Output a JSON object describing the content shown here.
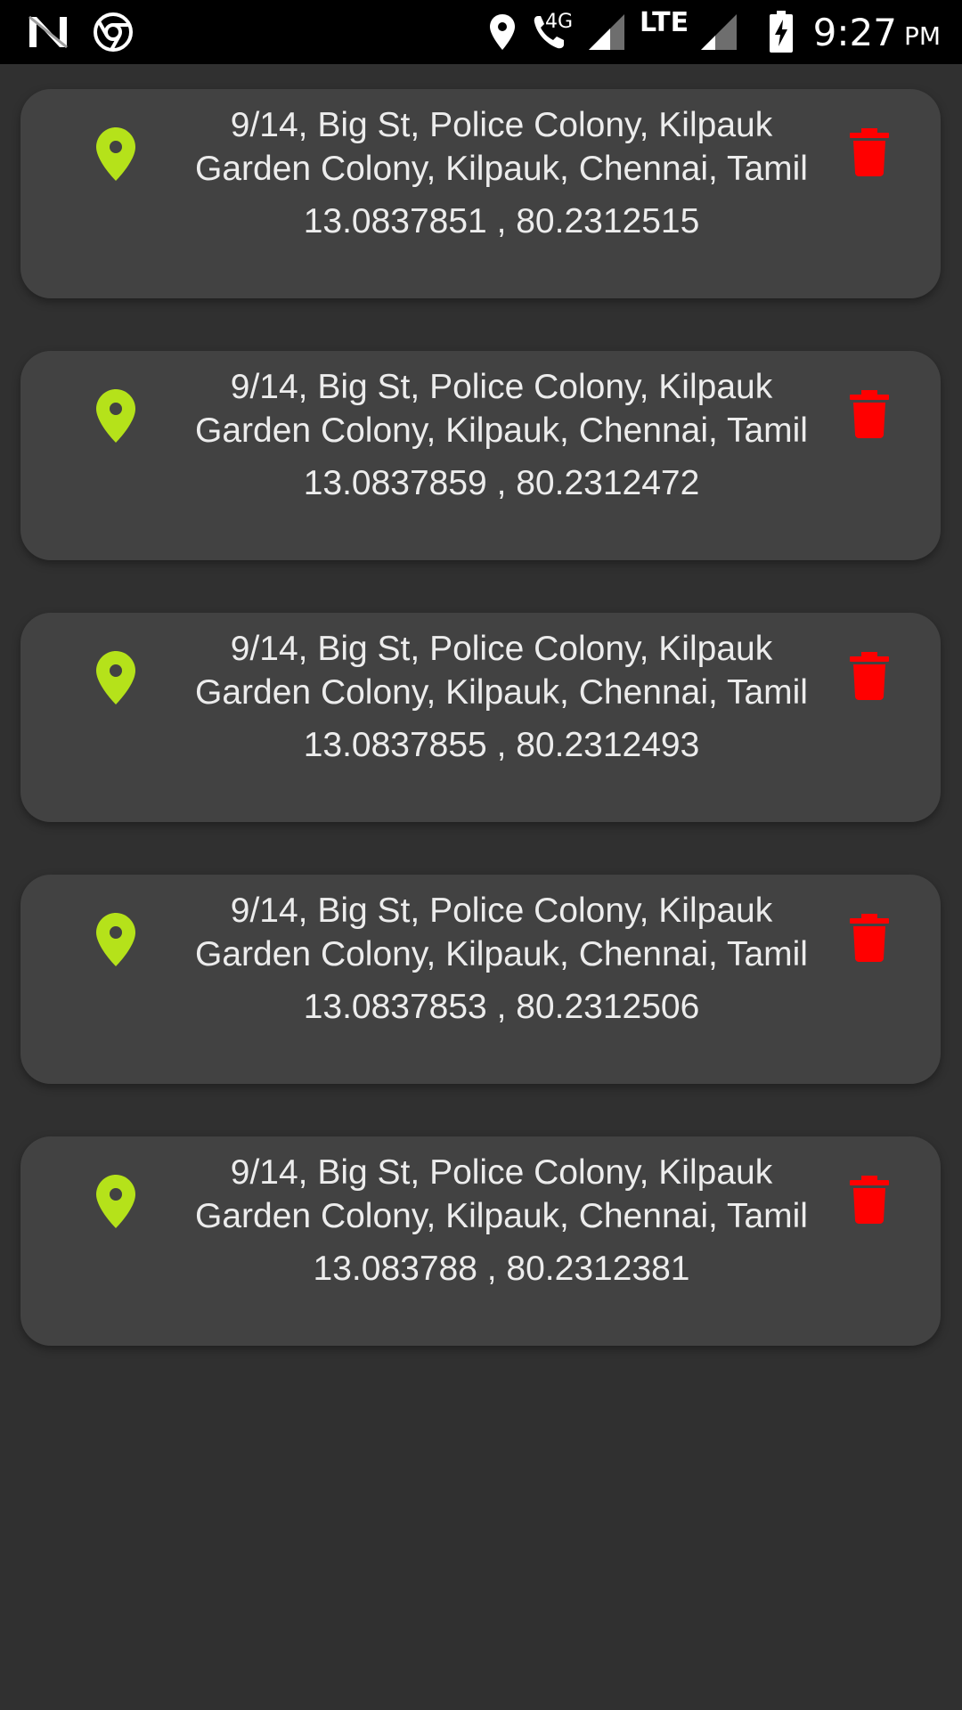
{
  "status_bar": {
    "time": "9:27",
    "ampm": "PM",
    "network_label": "4G",
    "lte_label": "LTE",
    "icons": [
      "n-notification-icon",
      "chrome-icon",
      "location-icon",
      "wifi-calling-icon",
      "signal-icon",
      "lte-signal-icon",
      "battery-charging-icon"
    ]
  },
  "colors": {
    "background": "#303030",
    "card": "#424242",
    "pin": "#b5e21a",
    "trash": "#ff0000"
  },
  "locations": [
    {
      "address_line1": "9/14, Big St, Police Colony, Kilpauk",
      "address_line2": "Garden Colony, Kilpauk, Chennai, Tamil",
      "coords": "13.0837851 , 80.2312515"
    },
    {
      "address_line1": "9/14, Big St, Police Colony, Kilpauk",
      "address_line2": "Garden Colony, Kilpauk, Chennai, Tamil",
      "coords": "13.0837859 , 80.2312472"
    },
    {
      "address_line1": "9/14, Big St, Police Colony, Kilpauk",
      "address_line2": "Garden Colony, Kilpauk, Chennai, Tamil",
      "coords": "13.0837855 , 80.2312493"
    },
    {
      "address_line1": "9/14, Big St, Police Colony, Kilpauk",
      "address_line2": "Garden Colony, Kilpauk, Chennai, Tamil",
      "coords": "13.0837853 , 80.2312506"
    },
    {
      "address_line1": "9/14, Big St, Police Colony, Kilpauk",
      "address_line2": "Garden Colony, Kilpauk, Chennai, Tamil",
      "coords": "13.083788 , 80.2312381"
    }
  ]
}
